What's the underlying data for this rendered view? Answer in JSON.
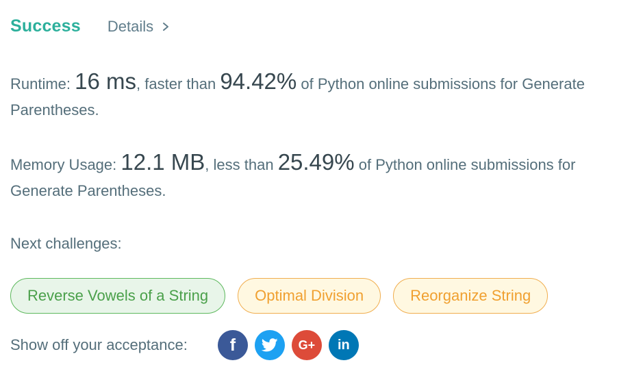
{
  "result": {
    "status": "Success",
    "details_label": "Details"
  },
  "runtime": {
    "label": "Runtime: ",
    "value": "16 ms",
    "mid": ", faster than ",
    "percent": "94.42%",
    "tail": " of Python online submissions for Generate Parentheses."
  },
  "memory": {
    "label": "Memory Usage: ",
    "value": "12.1 MB",
    "mid": ", less than ",
    "percent": "25.49%",
    "tail": " of Python online submissions for Generate Parentheses."
  },
  "next": {
    "label": "Next challenges:",
    "items": [
      {
        "label": "Reverse Vowels of a String",
        "difficulty": "easy"
      },
      {
        "label": "Optimal Division",
        "difficulty": "medium"
      },
      {
        "label": "Reorganize String",
        "difficulty": "medium"
      }
    ]
  },
  "share": {
    "label": "Show off your acceptance:",
    "icons": {
      "facebook": "f",
      "twitter": "twitter-bird-icon",
      "google_plus": "G+",
      "linkedin": "in"
    }
  },
  "colors": {
    "success": "#2db09c",
    "easy": "#5cb85c",
    "medium": "#f0ad4e",
    "facebook": "#3b5998",
    "twitter": "#1da1f2",
    "google_plus": "#dd4b39",
    "linkedin": "#0077b5"
  }
}
